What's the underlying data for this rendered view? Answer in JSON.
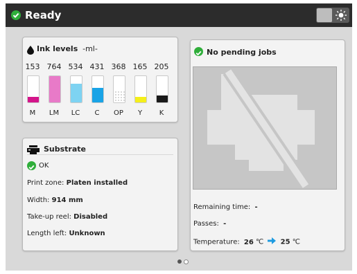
{
  "status": {
    "text": "Ready",
    "icon": "check-circle-icon",
    "color": "#2fae3a"
  },
  "topbar": {
    "brightness_icon": "brightness-icon"
  },
  "ink": {
    "title": "Ink levels",
    "unit": "-ml-",
    "icon": "ink-drop-icon",
    "cartridges": [
      {
        "label": "M",
        "value": "153",
        "color": "#d4158a",
        "level": 0.2
      },
      {
        "label": "LM",
        "value": "764",
        "color": "#e87ac8",
        "level": 1.0
      },
      {
        "label": "LC",
        "value": "534",
        "color": "#7ed3f2",
        "level": 0.7
      },
      {
        "label": "C",
        "value": "431",
        "color": "#19a3e6",
        "level": 0.56
      },
      {
        "label": "OP",
        "value": "368",
        "color": "#d8d8d8",
        "level": 0.48
      },
      {
        "label": "Y",
        "value": "165",
        "color": "#f5ef1a",
        "level": 0.22
      },
      {
        "label": "K",
        "value": "205",
        "color": "#1a1a1a",
        "level": 0.27
      }
    ]
  },
  "substrate": {
    "title": "Substrate",
    "icon": "printer-icon",
    "status": "OK",
    "rows": [
      {
        "label": "Print zone:",
        "value": "Platen installed"
      },
      {
        "label": "Width:",
        "value": "914 mm"
      },
      {
        "label": "Take-up reel:",
        "value": "Disabled"
      },
      {
        "label": "Length left:",
        "value": "Unknown"
      }
    ]
  },
  "jobs": {
    "title": "No pending jobs",
    "icon": "check-circle-icon",
    "preview_icon": "no-jobs-icon",
    "remaining_label": "Remaining time:",
    "remaining_value": "-",
    "passes_label": "Passes:",
    "passes_value": "-",
    "temperature_label": "Temperature:",
    "temp_current": "26",
    "temp_target": "25",
    "temp_unit": "℃",
    "arrow_color": "#1e9be0"
  },
  "pager": {
    "pages": 2,
    "current": 1
  }
}
